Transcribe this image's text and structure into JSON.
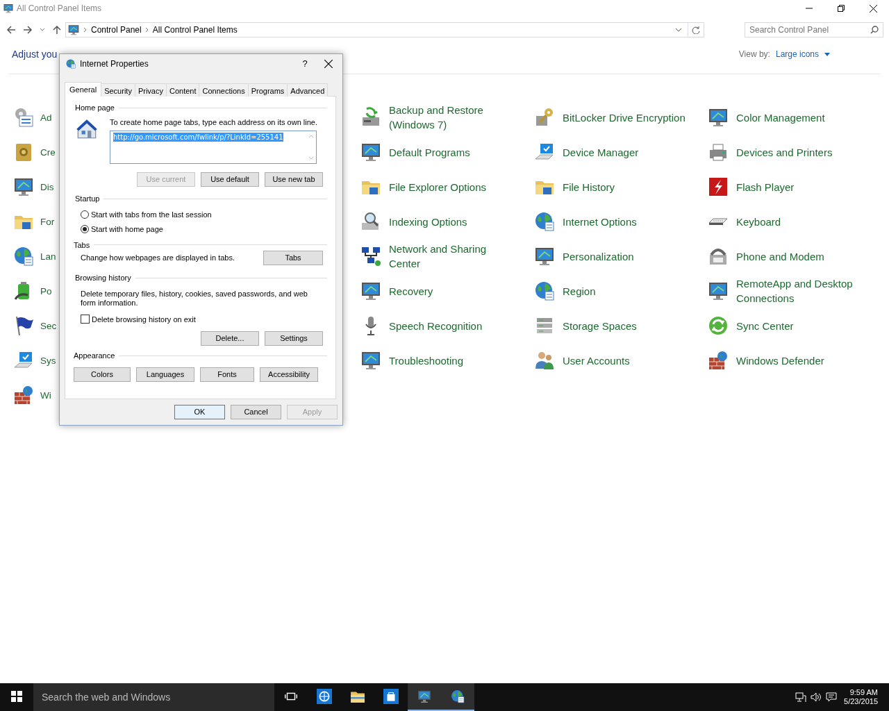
{
  "window": {
    "title": "All Control Panel Items"
  },
  "address": {
    "crumbs": [
      "Control Panel",
      "All Control Panel Items"
    ]
  },
  "search": {
    "placeholder": "Search Control Panel"
  },
  "heading": "Adjust you",
  "view_by": {
    "label": "View by:",
    "value": "Large icons"
  },
  "item_columns": [
    [
      "Ad",
      "Cre",
      "Dis",
      "For",
      "Lan",
      "Po",
      "Sec",
      "Sys",
      "Wi"
    ],
    [
      "Backup and Restore (Windows 7)",
      "Default Programs",
      "File Explorer Options",
      "Indexing Options",
      "Network and Sharing Center",
      "Recovery",
      "Speech Recognition",
      "Troubleshooting"
    ],
    [
      "BitLocker Drive Encryption",
      "Device Manager",
      "File History",
      "Internet Options",
      "Personalization",
      "Region",
      "Storage Spaces",
      "User Accounts"
    ],
    [
      "Color Management",
      "Devices and Printers",
      "Flash Player",
      "Keyboard",
      "Phone and Modem",
      "RemoteApp and Desktop Connections",
      "Sync Center",
      "Windows Defender"
    ]
  ],
  "dialog": {
    "title": "Internet Properties",
    "help": "?",
    "tabs": [
      {
        "label": "General",
        "selected": true
      },
      {
        "label": "Security",
        "selected": false
      },
      {
        "label": "Privacy",
        "selected": false
      },
      {
        "label": "Content",
        "selected": false
      },
      {
        "label": "Connections",
        "selected": false
      },
      {
        "label": "Programs",
        "selected": false
      },
      {
        "label": "Advanced",
        "selected": false
      }
    ],
    "home_page": {
      "heading": "Home page",
      "instruction": "To create home page tabs, type each address on its own line.",
      "value": "http://go.microsoft.com/fwlink/p/?LinkId=255141",
      "buttons": [
        {
          "label": "Use current",
          "disabled": true
        },
        {
          "label": "Use default",
          "disabled": false
        },
        {
          "label": "Use new tab",
          "disabled": false
        }
      ]
    },
    "startup": {
      "heading": "Startup",
      "options": [
        {
          "label": "Start with tabs from the last session",
          "selected": false
        },
        {
          "label": "Start with home page",
          "selected": true
        }
      ]
    },
    "tabs_section": {
      "heading": "Tabs",
      "text": "Change how webpages are displayed in tabs.",
      "button": "Tabs"
    },
    "browsing_history": {
      "heading": "Browsing history",
      "text": "Delete temporary files, history, cookies, saved passwords, and web form information.",
      "checkbox": {
        "label": "Delete browsing history on exit",
        "checked": false
      },
      "buttons": [
        "Delete...",
        "Settings"
      ]
    },
    "appearance": {
      "heading": "Appearance",
      "buttons": [
        "Colors",
        "Languages",
        "Fonts",
        "Accessibility"
      ]
    },
    "footer": [
      {
        "label": "OK",
        "disabled": false
      },
      {
        "label": "Cancel",
        "disabled": false
      },
      {
        "label": "Apply",
        "disabled": true
      }
    ]
  },
  "taskbar": {
    "search_placeholder": "Search the web and Windows",
    "apps": [
      {
        "active": false
      },
      {
        "active": false
      },
      {
        "active": false
      },
      {
        "active": false
      },
      {
        "active": true
      },
      {
        "active": true
      }
    ],
    "time": "9:59 AM",
    "date": "5/23/2015"
  }
}
